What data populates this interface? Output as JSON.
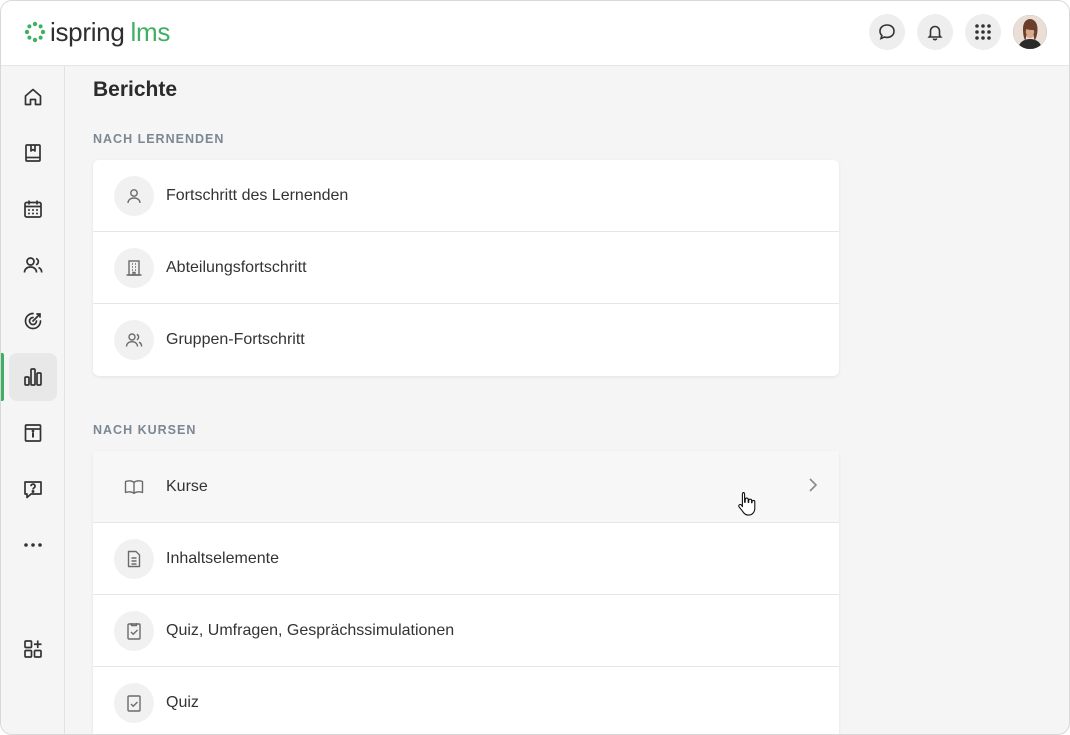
{
  "app": {
    "logo_primary": "ispring",
    "logo_secondary": "lms",
    "brand_color": "#3fb063"
  },
  "header": {
    "actions": [
      "chat-icon",
      "bell-icon",
      "apps-grid-icon"
    ],
    "avatar": "user-avatar"
  },
  "sidebar": {
    "items": [
      {
        "icon": "home-icon",
        "active": false
      },
      {
        "icon": "book-icon",
        "active": false
      },
      {
        "icon": "calendar-icon",
        "active": false
      },
      {
        "icon": "users-icon",
        "active": false
      },
      {
        "icon": "target-icon",
        "active": false
      },
      {
        "icon": "reports-icon",
        "active": true
      },
      {
        "icon": "info-archive-icon",
        "active": false
      },
      {
        "icon": "help-chat-icon",
        "active": false
      },
      {
        "icon": "more-icon",
        "active": false
      },
      {
        "icon": "add-widget-icon",
        "active": false
      }
    ]
  },
  "page": {
    "title": "Berichte",
    "sections": [
      {
        "label": "NACH LERNENDEN",
        "rows": [
          {
            "label": "Fortschritt des Lernenden",
            "icon": "person-icon"
          },
          {
            "label": "Abteilungsfortschritt",
            "icon": "building-icon"
          },
          {
            "label": "Gruppen-Fortschritt",
            "icon": "group-icon"
          }
        ]
      },
      {
        "label": "NACH KURSEN",
        "rows": [
          {
            "label": "Kurse",
            "icon": "open-book-icon",
            "hovered": true
          },
          {
            "label": "Inhaltselemente",
            "icon": "document-icon"
          },
          {
            "label": "Quiz, Umfragen, Gesprächssimulationen",
            "icon": "checklist-icon"
          },
          {
            "label": "Quiz",
            "icon": "checkbox-doc-icon"
          }
        ]
      }
    ]
  }
}
